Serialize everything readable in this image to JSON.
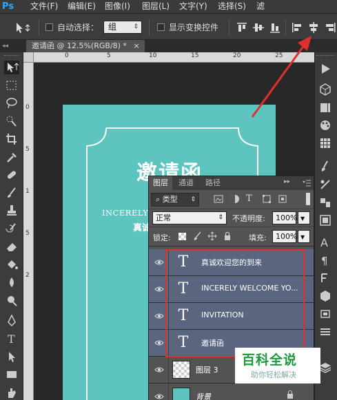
{
  "app": {
    "logo": "Ps"
  },
  "menu": [
    "文件(F)",
    "编辑(E)",
    "图像(I)",
    "图层(L)",
    "文字(Y)",
    "选择(S)",
    "滤"
  ],
  "options": {
    "auto_select_label": "自动选择：",
    "auto_select_value": "组",
    "show_transform_label": "显示变换控件"
  },
  "document_tab": {
    "title": "邀请函 @ 12.5%(RGB/8) *",
    "close": "×"
  },
  "ruler": {
    "top_numbers": [
      "0",
      "5",
      "10",
      "15",
      "20",
      "25"
    ],
    "left_numbers": [
      "0",
      "5",
      "1",
      "5",
      "2"
    ]
  },
  "canvas": {
    "title": "邀请函",
    "english": "INCERELY W",
    "chinese": "真诚",
    "bg_color": "#5ec4bf"
  },
  "layers_panel": {
    "tabs": [
      "图层",
      "通道",
      "路径"
    ],
    "filter_label": "类型",
    "blend_mode": "正常",
    "opacity_label": "不透明度:",
    "opacity_value": "100%",
    "lock_label": "锁定:",
    "fill_label": "填充:",
    "fill_value": "100%",
    "layers": [
      {
        "name": "真诚欢迎您的到来",
        "kind": "text",
        "selected": true
      },
      {
        "name": "INCERELY WELCOME YO...",
        "kind": "text",
        "selected": true
      },
      {
        "name": "INVITATION",
        "kind": "text",
        "selected": true
      },
      {
        "name": "邀请函",
        "kind": "text",
        "selected": true
      },
      {
        "name": "图层 3",
        "kind": "pixel",
        "selected": false
      },
      {
        "name": "背景",
        "kind": "background",
        "selected": false
      }
    ]
  },
  "watermark": {
    "title": "百科全说",
    "subtitle": "助你轻松解决"
  },
  "colors": {
    "highlight": "#e0302d",
    "selection": "#5a6680",
    "ps_blue": "#31a8ff"
  }
}
